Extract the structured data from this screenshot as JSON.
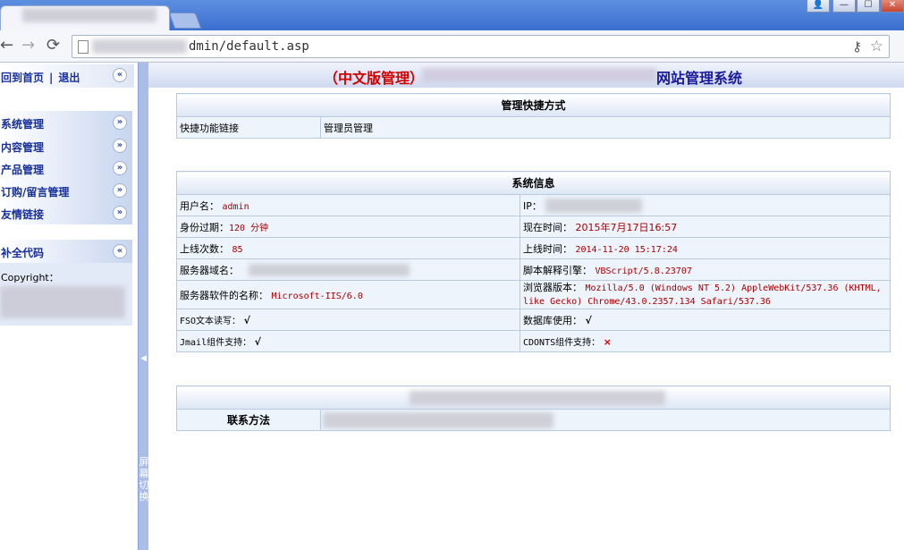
{
  "browser": {
    "url_suffix": "dmin/default.asp",
    "window_buttons": [
      "👤",
      "—",
      "☐",
      "✕"
    ]
  },
  "sidebar": {
    "top_links": {
      "home": "回到首页",
      "separator": "|",
      "logout": "退出"
    },
    "menus": [
      {
        "label": "系统管理"
      },
      {
        "label": "内容管理"
      },
      {
        "label": "产品管理"
      },
      {
        "label": "订购/留言管理"
      },
      {
        "label": "友情链接"
      }
    ],
    "extra_menu": {
      "label": "补全代码"
    },
    "copyright_label": "Copyright："
  },
  "splitter": {
    "text": "屏幕切换"
  },
  "main": {
    "title_prefix": "（中文版管理）",
    "title_suffix": "网站管理系统",
    "shortcuts": {
      "header": "管理快捷方式",
      "row_label": "快捷功能链接",
      "row_value": "管理员管理"
    },
    "sysinfo": {
      "header": "系统信息",
      "rows": [
        {
          "l_label": "用户名：",
          "l_value": "admin",
          "r_label": "IP：",
          "r_value": ""
        },
        {
          "l_label": "身份过期：",
          "l_value": "120 分钟",
          "r_label": "现在时间：",
          "r_value": "2015年7月17日16:57"
        },
        {
          "l_label": "上线次数：",
          "l_value": "85",
          "r_label": "上线时间：",
          "r_value": "2014-11-20 15:17:24"
        },
        {
          "l_label": "服务器域名：",
          "l_value": "",
          "r_label": "脚本解释引擎：",
          "r_value": "VBScript/5.8.23707"
        },
        {
          "l_label": "服务器软件的名称：",
          "l_value": "Microsoft-IIS/6.0",
          "r_label": "浏览器版本：",
          "r_value": "Mozilla/5.0 (Windows NT 5.2) AppleWebKit/537.36 (KHTML, like Gecko) Chrome/43.0.2357.134 Safari/537.36"
        },
        {
          "l_label": "FSO文本读写：",
          "l_value": "√",
          "r_label": "数据库使用：",
          "r_value": "√"
        },
        {
          "l_label": "Jmail组件支持：",
          "l_value": "√",
          "r_label": "CDONTS组件支持：",
          "r_value": "×"
        }
      ]
    },
    "contact": {
      "label": "联系方法"
    }
  }
}
